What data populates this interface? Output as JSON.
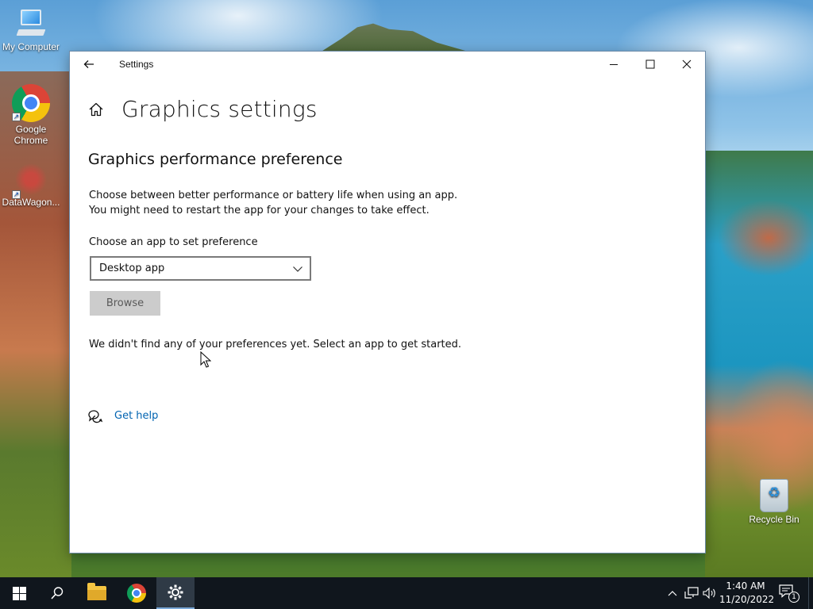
{
  "desktop": {
    "icons": [
      {
        "label": "My Computer",
        "icon": "monitor-icon"
      },
      {
        "label": "Google Chrome",
        "icon": "chrome-icon"
      },
      {
        "label": "DataWagon...",
        "icon": "datawagon-icon"
      },
      {
        "label": "Recycle Bin",
        "icon": "recycle-bin-icon"
      }
    ]
  },
  "window": {
    "title": "Settings",
    "page_title": "Graphics settings",
    "section_title": "Graphics performance preference",
    "description_line1": "Choose between better performance or battery life when using an app.",
    "description_line2": "You might need to restart the app for your changes to take effect.",
    "choose_label": "Choose an app to set preference",
    "dropdown_value": "Desktop app",
    "browse_label": "Browse",
    "empty_message": "We didn't find any of your preferences yet. Select an app to get started.",
    "help_label": "Get help"
  },
  "taskbar": {
    "apps": [
      "start-icon",
      "search-icon",
      "file-explorer-icon",
      "chrome-icon",
      "settings-icon"
    ],
    "active_app": "settings-icon",
    "time": "1:40 AM",
    "date": "11/20/2022",
    "notification_count": "1"
  },
  "colors": {
    "link": "#0063b1",
    "taskbar": "#10161d",
    "button_disabled": "#cccccc"
  }
}
